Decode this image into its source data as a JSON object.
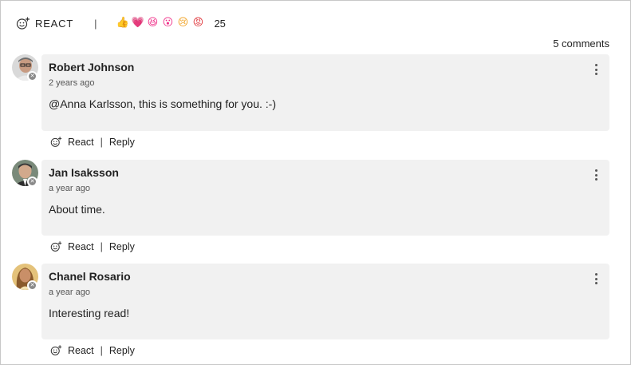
{
  "react_bar": {
    "label": "REACT",
    "separator": "|",
    "emojis": [
      {
        "name": "thumbs-up-icon",
        "glyph": "👍",
        "color": "#f2a31b"
      },
      {
        "name": "heart-icon",
        "glyph": "💗",
        "color": "#e3347b"
      },
      {
        "name": "laughing-icon",
        "glyph": "😆",
        "color": "#f0328a"
      },
      {
        "name": "surprised-icon",
        "glyph": "😮",
        "color": "#f0328a"
      },
      {
        "name": "sad-icon",
        "glyph": "😢",
        "color": "#f0a020"
      },
      {
        "name": "angry-icon",
        "glyph": "😡",
        "color": "#e0383d"
      }
    ],
    "count": "25"
  },
  "comments_count": "5 comments",
  "comments": [
    {
      "name": "Robert Johnson",
      "time": "2 years ago",
      "text": "@Anna Karlsson, this is something for you. :-)",
      "react_label": "React",
      "reply_label": "Reply",
      "separator": "|"
    },
    {
      "name": "Jan Isaksson",
      "time": "a year ago",
      "text": "About time.",
      "react_label": "React",
      "reply_label": "Reply",
      "separator": "|"
    },
    {
      "name": "Chanel Rosario",
      "time": "a year ago",
      "text": "Interesting read!",
      "react_label": "React",
      "reply_label": "Reply",
      "separator": "|"
    }
  ]
}
